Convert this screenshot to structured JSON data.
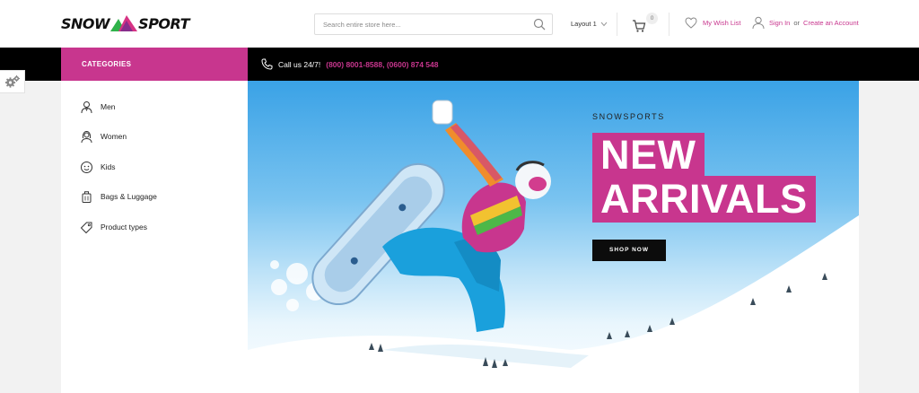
{
  "brand": {
    "logo_left": "SNOW",
    "logo_right": "SPORT"
  },
  "search": {
    "placeholder": "Search entire store here..."
  },
  "header": {
    "layout_label": "Layout 1",
    "cart_count": "0",
    "wishlist_label": "My Wish List",
    "signin_label": "Sign In",
    "or_label": "or",
    "create_account_label": "Create an Account"
  },
  "navbar": {
    "categories_label": "CATEGORIES",
    "call_prefix": "Call us 24/7!",
    "call_numbers": "(800) 8001-8588, (0600) 874 548"
  },
  "sidebar": {
    "items": [
      {
        "label": "Men",
        "icon": "man-icon"
      },
      {
        "label": "Women",
        "icon": "woman-icon"
      },
      {
        "label": "Kids",
        "icon": "kid-face-icon"
      },
      {
        "label": "Bags & Luggage",
        "icon": "luggage-icon"
      },
      {
        "label": "Product types",
        "icon": "tag-icon"
      }
    ]
  },
  "banner": {
    "eyebrow": "SNOWSPORTS",
    "headline_line1": "NEW",
    "headline_line2": "ARRIVALS",
    "cta": "SHOP NOW"
  },
  "colors": {
    "accent": "#c8368e",
    "navbar": "#000000",
    "logo_mountain_green": "#2fb24a",
    "logo_mountain_pink": "#d63384"
  }
}
